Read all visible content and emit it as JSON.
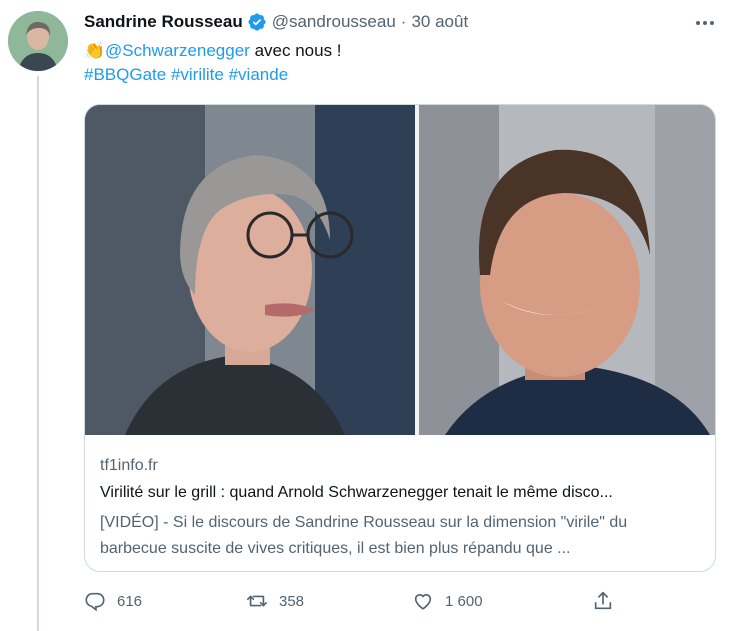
{
  "author": {
    "name": "Sandrine Rousseau",
    "handle": "@sandrousseau",
    "separator": "·",
    "date": "30 août"
  },
  "tweet": {
    "mention": "@Schwarzenegger",
    "text_after_mention": " avec nous !",
    "hashtags": [
      "#BBQGate",
      "#virilite",
      "#viande"
    ]
  },
  "card": {
    "domain": "tf1info.fr",
    "title": "Virilité sur le grill : quand Arnold Schwarzenegger tenait le même disco...",
    "description": "[VIDÉO] - Si le discours de Sandrine Rousseau sur la dimension \"virile\" du barbecue suscite de vives critiques, il est bien plus répandu que ..."
  },
  "actions": {
    "replies": "616",
    "retweets": "358",
    "likes": "1 600"
  },
  "colors": {
    "accent": "#1d9bf0",
    "secondary_text": "#536471",
    "border": "#cfd9de"
  },
  "icons": [
    "verified-badge-icon",
    "more-options-icon",
    "clapping-hands-emoji",
    "reply-icon",
    "retweet-icon",
    "like-icon",
    "share-icon"
  ]
}
